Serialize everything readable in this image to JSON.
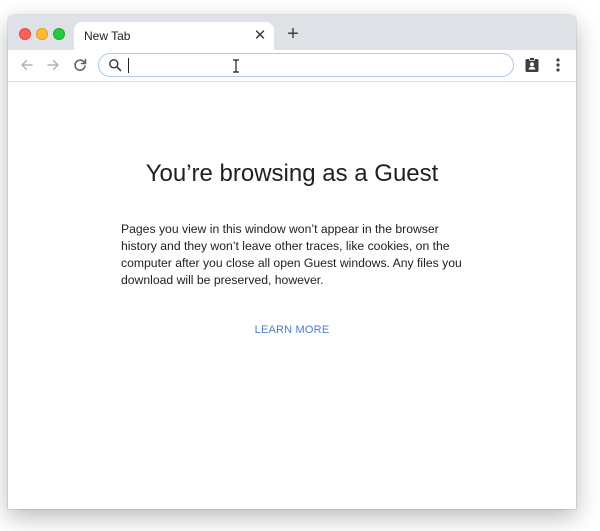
{
  "browser": {
    "tab": {
      "title": "New Tab",
      "close_icon": "close-icon"
    },
    "new_tab_icon": "plus-icon",
    "toolbar": {
      "back_icon": "arrow-left-icon",
      "forward_icon": "arrow-right-icon",
      "reload_icon": "reload-icon",
      "omnibox": {
        "value": "",
        "placeholder": "",
        "search_icon": "search-icon"
      },
      "profile_icon": "guest-profile-icon",
      "menu_icon": "kebab-menu-icon"
    }
  },
  "page": {
    "headline": "You’re browsing as a Guest",
    "body": "Pages you view in this window won’t appear in the browser history and they won’t leave other traces, like cookies, on the computer after you close all open Guest windows. Any files you download will be preserved, however.",
    "learn_more": "LEARN MORE"
  },
  "colors": {
    "link": "#4a7dc9",
    "omnibox_focus": "#a8c7fa",
    "titlebar": "#dee1e6"
  }
}
